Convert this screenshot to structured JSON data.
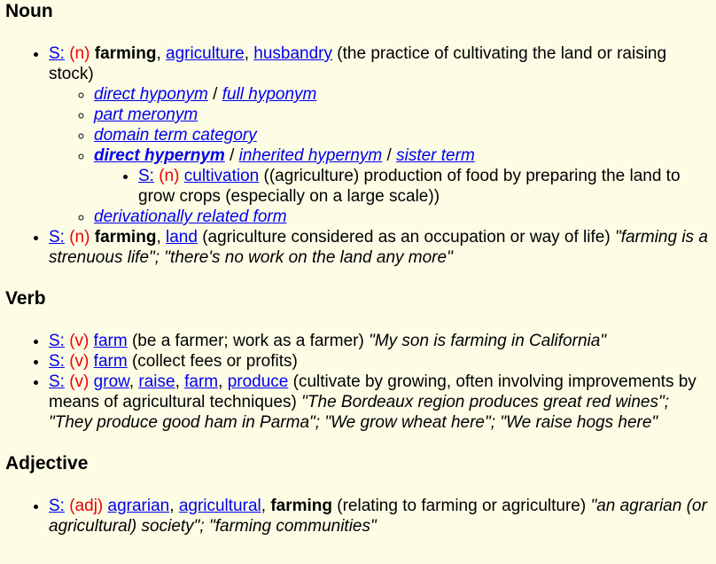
{
  "sections": {
    "noun": {
      "heading": "Noun",
      "s1": {
        "s_link": "S:",
        "pos": "(n)",
        "head": "farming",
        "sep1": ",",
        "syn1": "agriculture",
        "sep2": ",",
        "syn2": "husbandry",
        "gloss": "(the practice of cultivating the land or raising stock)",
        "rels": {
          "direct_hyponym": "direct hyponym",
          "slash1": "/",
          "full_hyponym": "full hyponym",
          "part_meronym": "part meronym",
          "domain_term_category": "domain term category",
          "direct_hypernym": "direct hypernym",
          "slash2": "/",
          "inherited_hypernym": "inherited hypernym",
          "slash3": "/",
          "sister_term": "sister term",
          "derivationally_related_form": "derivationally related form"
        },
        "hypernym": {
          "s_link": "S:",
          "pos": "(n)",
          "word": "cultivation",
          "gloss": "((agriculture) production of food by preparing the land to grow crops (especially on a large scale))"
        }
      },
      "s2": {
        "s_link": "S:",
        "pos": "(n)",
        "head": "farming",
        "sep1": ",",
        "syn1": "land",
        "gloss": "(agriculture considered as an occupation or way of life)",
        "examples": "\"farming is a strenuous life\"; \"there's no work on the land any more\""
      }
    },
    "verb": {
      "heading": "Verb",
      "s1": {
        "s_link": "S:",
        "pos": "(v)",
        "word": "farm",
        "gloss": "(be a farmer; work as a farmer)",
        "examples": "\"My son is farming in California\""
      },
      "s2": {
        "s_link": "S:",
        "pos": "(v)",
        "word": "farm",
        "gloss": "(collect fees or profits)"
      },
      "s3": {
        "s_link": "S:",
        "pos": "(v)",
        "w1": "grow",
        "sep1": ",",
        "w2": "raise",
        "sep2": ",",
        "w3": "farm",
        "sep3": ",",
        "w4": "produce",
        "gloss": "(cultivate by growing, often involving improvements by means of agricultural techniques)",
        "examples": "\"The Bordeaux region produces great red wines\"; \"They produce good ham in Parma\"; \"We grow wheat here\"; \"We raise hogs here\""
      }
    },
    "adjective": {
      "heading": "Adjective",
      "s1": {
        "s_link": "S:",
        "pos": "(adj)",
        "w1": "agrarian",
        "sep1": ",",
        "w2": "agricultural",
        "sep2": ",",
        "head": "farming",
        "gloss": "(relating to farming or agriculture)",
        "examples": "\"an agrarian (or agricultural) society\"; \"farming communities\""
      }
    }
  }
}
